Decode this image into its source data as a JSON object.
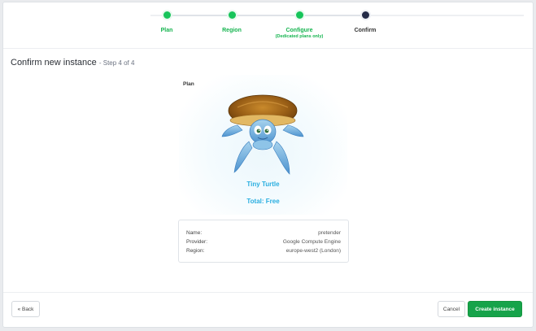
{
  "stepper": {
    "steps": [
      {
        "label": "Plan",
        "sublabel": "",
        "state": "done"
      },
      {
        "label": "Region",
        "sublabel": "",
        "state": "done"
      },
      {
        "label": "Configure",
        "sublabel": "(Dedicated plans only)",
        "state": "done"
      },
      {
        "label": "Confirm",
        "sublabel": "",
        "state": "current"
      }
    ],
    "colors": {
      "done": "#17c45a",
      "current": "#232a47"
    }
  },
  "heading": {
    "title": "Confirm new instance",
    "step_info": "- Step 4 of 4"
  },
  "plan_card": {
    "section_label": "Plan",
    "image_icon": "turtle-mascot-icon",
    "plan_name": "Tiny Turtle",
    "total": "Total: Free",
    "accent_color": "#29aee0"
  },
  "details": {
    "name_label": "Name:",
    "name_value": "pretender",
    "provider_label": "Provider:",
    "provider_value": "Google Compute Engine",
    "region_label": "Region:",
    "region_value": "europe-west2 (London)"
  },
  "footer": {
    "back_label": "« Back",
    "cancel_label": "Cancel",
    "create_label": "Create instance",
    "primary_color": "#16a34a"
  }
}
